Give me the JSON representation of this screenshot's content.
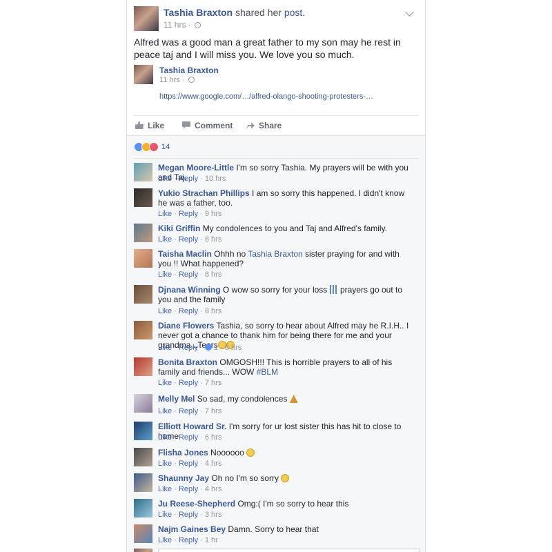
{
  "post": {
    "author": "Tashia Braxton",
    "shared_text": " shared her ",
    "shared_link": "post",
    "shared_end": ".",
    "time": "11 hrs",
    "text": "Alfred was a good man a great father to my son may he rest in peace taj and I will miss you. We love you so much.",
    "shared_post": {
      "author": "Tashia Braxton",
      "time": "11 hrs",
      "link": "https://www.google.com/…/alfred-olango-shooting-protesters-…"
    }
  },
  "actions": {
    "like": "Like",
    "comment": "Comment",
    "share": "Share"
  },
  "reactions": {
    "count": "14",
    "icons": [
      "like-reaction-icon",
      "sad-reaction-icon",
      "love-reaction-icon"
    ]
  },
  "comment_actions": {
    "like": "Like",
    "reply": "Reply",
    "separator": " · "
  },
  "comments": [
    {
      "name": "Megan Moore-Little",
      "text": "I'm so sorry Tashia. My prayers will be with you and Taj.",
      "time": "10 hrs"
    },
    {
      "name": "Yukio Strachan Phillips",
      "text": "I am so sorry this happened. I didn't know he was a father, too.",
      "time": "9 hrs"
    },
    {
      "name": "Kiki Griffin",
      "text": "My condolences to you and Taj and Alfred's family.",
      "time": "8 hrs"
    },
    {
      "name": "Taisha Maclin",
      "text_before": "Ohhh no ",
      "mention": "Tashia Braxton",
      "text_after": " sister praying for and with you !! What happened?",
      "time": "8 hrs"
    },
    {
      "name": "Djnana Winning",
      "text_before": "O wow so sorry for your loss ",
      "text_after": " prayers go out to you and the family",
      "time": "8 hrs"
    },
    {
      "name": "Diane Flowers",
      "text": "Tashia, so sorry to hear about Alfred may he R.I.H.. I never got a chance to thank him for being there for me and your grandma...Tears",
      "likes": "1",
      "time": "8 hrs"
    },
    {
      "name": "Bonita Braxton",
      "text": "OMGOSH!!! This is horrible prayers to all of his family and friends... WOW ",
      "hashtag": "#BLM",
      "time": "7 hrs"
    },
    {
      "name": "Melly Mel",
      "text": "So sad, my condolences ",
      "time": "7 hrs"
    },
    {
      "name": "Elliott Howard Sr.",
      "text": "I'm sorry for ur lost sister this has hit to close to home",
      "time": "6 hrs"
    },
    {
      "name": "Flisha Jones",
      "text": "Noooooo ",
      "time": "4 hrs"
    },
    {
      "name": "Shaunny Jay",
      "text": "Oh no I'm so sorry ",
      "time": "4 hrs"
    },
    {
      "name": "Ju Reese-Shepherd",
      "text": "Omg:( I'm so sorry to hear this",
      "time": "3 hrs"
    },
    {
      "name": "Najm Gaines Bey",
      "text": "Damn. Sorry to hear that",
      "time": "1 hr"
    }
  ]
}
